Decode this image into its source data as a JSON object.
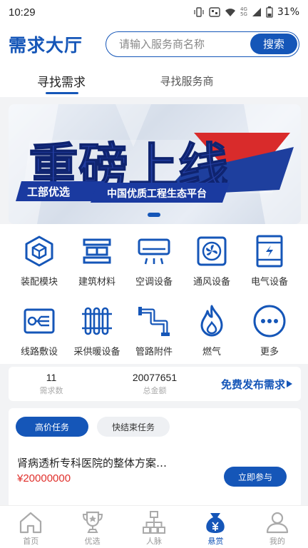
{
  "status_bar": {
    "time": "10:29",
    "network_top": "4G",
    "network_bottom": "5G",
    "battery": "31%"
  },
  "header": {
    "logo": "需求大厅",
    "search_placeholder": "请输入服务商名称",
    "search_button": "搜索"
  },
  "tabs": [
    {
      "label": "寻找需求"
    },
    {
      "label": "寻找服务商"
    }
  ],
  "banner": {
    "headline": "重磅上线",
    "tag": "工部优选",
    "slogan": "中国优质工程生态平台"
  },
  "categories": [
    {
      "label": "装配模块",
      "icon": "cube-icon"
    },
    {
      "label": "建筑材料",
      "icon": "building-materials-icon"
    },
    {
      "label": "空调设备",
      "icon": "air-conditioner-icon"
    },
    {
      "label": "通风设备",
      "icon": "fan-icon"
    },
    {
      "label": "电气设备",
      "icon": "electrical-cabinet-icon"
    },
    {
      "label": "线路敷设",
      "icon": "cable-icon"
    },
    {
      "label": "采供暖设备",
      "icon": "radiator-icon"
    },
    {
      "label": "管路附件",
      "icon": "pipe-icon"
    },
    {
      "label": "燃气",
      "icon": "flame-icon"
    },
    {
      "label": "更多",
      "icon": "more-icon"
    }
  ],
  "stats": {
    "demand_count": {
      "value": "11",
      "label": "需求数"
    },
    "total_amount": {
      "value": "20077651",
      "label": "总金额"
    },
    "publish_label": "免费发布需求"
  },
  "tasks": {
    "filters": [
      {
        "label": "高价任务"
      },
      {
        "label": "快结束任务"
      }
    ],
    "item": {
      "title": "肾病透析专科医院的整体方案…",
      "price": "¥20000000",
      "action": "立即参与"
    }
  },
  "tabbar": [
    {
      "label": "首页",
      "icon": "home-icon"
    },
    {
      "label": "优选",
      "icon": "trophy-icon"
    },
    {
      "label": "人脉",
      "icon": "network-icon"
    },
    {
      "label": "悬赏",
      "icon": "reward-bag-icon"
    },
    {
      "label": "我的",
      "icon": "user-icon"
    }
  ],
  "colors": {
    "brand": "#1556b8",
    "price": "#e0302c",
    "accent_red": "#d92b2b"
  }
}
